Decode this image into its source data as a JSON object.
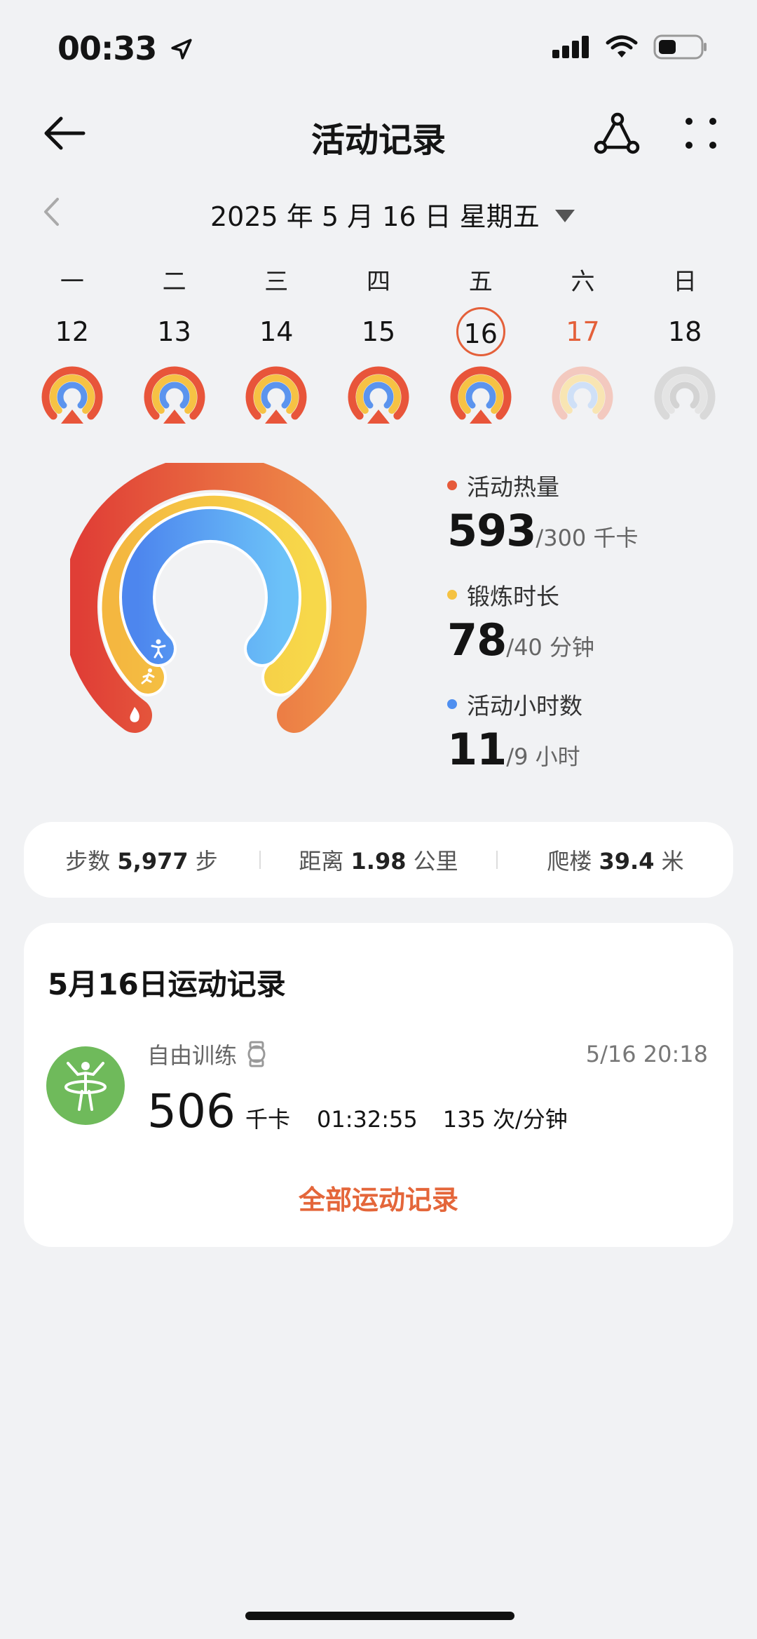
{
  "status_bar": {
    "time": "00:33"
  },
  "header": {
    "title": "活动记录"
  },
  "date": {
    "label": "2025 年 5 月 16 日  星期五"
  },
  "week": [
    {
      "name": "一",
      "num": "12",
      "state": "full"
    },
    {
      "name": "二",
      "num": "13",
      "state": "full"
    },
    {
      "name": "三",
      "num": "14",
      "state": "full"
    },
    {
      "name": "四",
      "num": "15",
      "state": "full"
    },
    {
      "name": "五",
      "num": "16",
      "state": "full",
      "selected": true
    },
    {
      "name": "六",
      "num": "17",
      "state": "faded",
      "highlight": true
    },
    {
      "name": "日",
      "num": "18",
      "state": "empty"
    }
  ],
  "metrics": [
    {
      "label": "活动热量",
      "value": "593",
      "goal": "/300 千卡",
      "color": "#e65a3a"
    },
    {
      "label": "锻炼时长",
      "value": "78",
      "goal": "/40 分钟",
      "color": "#f5c242"
    },
    {
      "label": "活动小时数",
      "value": "11",
      "goal": "/9 小时",
      "color": "#4f8ff0"
    }
  ],
  "summary": {
    "steps_label": "步数",
    "steps_value": "5,977",
    "steps_unit": "步",
    "distance_label": "距离",
    "distance_value": "1.98",
    "distance_unit": "公里",
    "floors_label": "爬楼",
    "floors_value": "39.4",
    "floors_unit": "米"
  },
  "workout": {
    "title": "5月16日运动记录",
    "name": "自由训练",
    "time": "5/16 20:18",
    "kcal": "506",
    "kcal_unit": "千卡",
    "duration": "01:32:55",
    "heart_rate": "135 次/分钟",
    "all_records": "全部运动记录"
  },
  "colors": {
    "accent": "#e4663a",
    "red": "#e65a3a",
    "yellow": "#f5c242",
    "blue": "#4f8ff0",
    "avatar": "#6fba5b"
  }
}
